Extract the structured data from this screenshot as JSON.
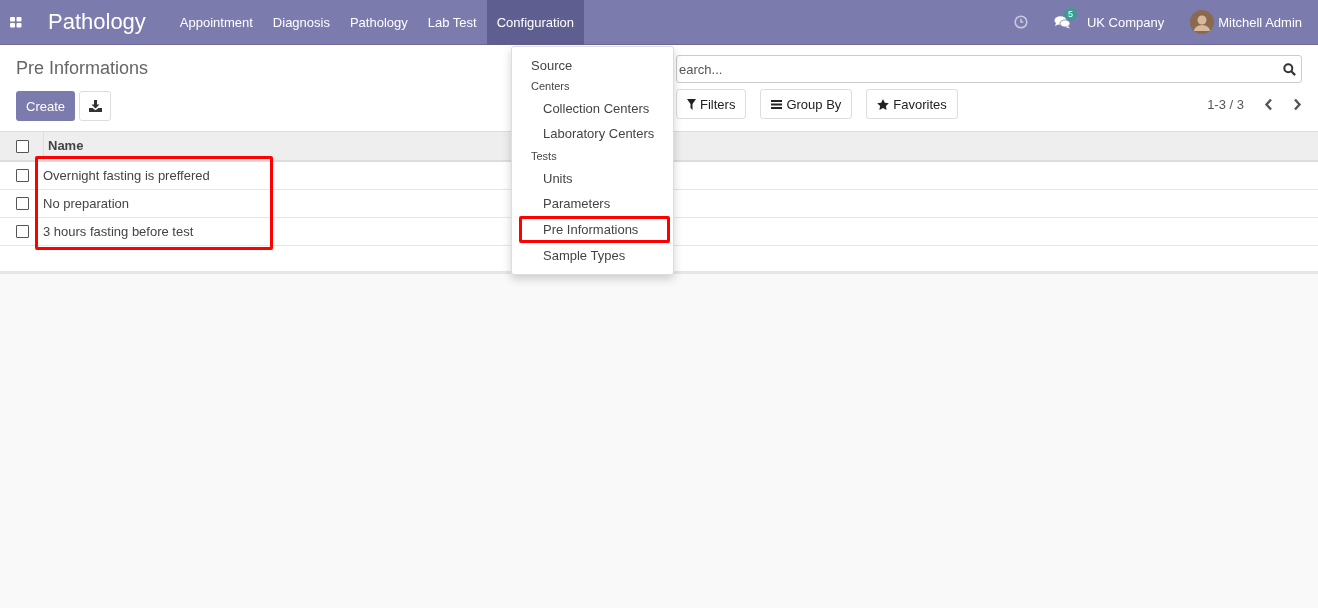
{
  "navbar": {
    "app_title": "Pathology",
    "menus": [
      {
        "label": "Appointment",
        "selected": false
      },
      {
        "label": "Diagnosis",
        "selected": false
      },
      {
        "label": "Pathology",
        "selected": false
      },
      {
        "label": "Lab Test",
        "selected": false
      },
      {
        "label": "Configuration",
        "selected": true
      }
    ],
    "message_count": "5",
    "company": "UK Company",
    "user": "Mitchell Admin"
  },
  "dropdown": {
    "items": [
      {
        "kind": "item",
        "label": "Source",
        "highlighted": false
      },
      {
        "kind": "header",
        "label": "Centers",
        "highlighted": false
      },
      {
        "kind": "subitem",
        "label": "Collection Centers",
        "highlighted": false
      },
      {
        "kind": "subitem",
        "label": "Laboratory Centers",
        "highlighted": false
      },
      {
        "kind": "header",
        "label": "Tests",
        "highlighted": false
      },
      {
        "kind": "subitem",
        "label": "Units",
        "highlighted": false
      },
      {
        "kind": "subitem",
        "label": "Parameters",
        "highlighted": false
      },
      {
        "kind": "subitem",
        "label": "Pre Informations",
        "highlighted": true
      },
      {
        "kind": "subitem",
        "label": "Sample Types",
        "highlighted": false
      }
    ]
  },
  "control_panel": {
    "breadcrumb": "Pre Informations",
    "create_button": "Create",
    "search": {
      "placeholder": "earch..."
    },
    "filters": [
      "Filters",
      "Group By",
      "Favorites"
    ],
    "pager": "1-3 / 3"
  },
  "table": {
    "all_checked": false,
    "columns": [
      "Name"
    ],
    "rows_highlighted": true,
    "rows": [
      {
        "name": "Overnight fasting is preffered",
        "checked": false
      },
      {
        "name": "No preparation",
        "checked": false
      },
      {
        "name": "3 hours fasting before test",
        "checked": false
      }
    ]
  }
}
